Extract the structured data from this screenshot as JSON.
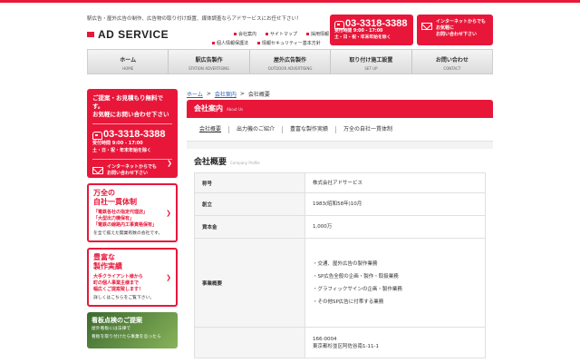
{
  "header": {
    "tagline": "駅広告・屋外広告の制作、広告物の取り付け設置、媒体調査ならアドサービスにお任せ下さい！",
    "logo_text": "AD SERVICE",
    "util_links_row1": [
      "会社案内",
      "サイトマップ",
      "採用情報"
    ],
    "util_links_row2": [
      "個人情報保護法",
      "情報セキュリティー基本方針"
    ],
    "phone": {
      "number": "03-3318-3388",
      "hours": "受付時間 9:00 - 17:00",
      "closed": "土・日・祝・年末年始を除く"
    },
    "net_contact": {
      "line1": "インターネットからでも",
      "line2": "お気軽に",
      "line3": "お問い合わせ下さい"
    }
  },
  "nav": [
    {
      "jp": "ホーム",
      "en": "HOME"
    },
    {
      "jp": "駅広告製作",
      "en": "STATION ADVERTISING"
    },
    {
      "jp": "屋外広告製作",
      "en": "OUTDOOR ADVERTISING"
    },
    {
      "jp": "取り付け施工設置",
      "en": "SET UP"
    },
    {
      "jp": "お問い合わせ",
      "en": "CONTACT"
    }
  ],
  "sidebar": {
    "contact": {
      "line1": "ご提案・お見積もり無料です。",
      "line2": "お気軽にお問い合わせ下さい",
      "number": "03-3318-3388",
      "hours": "受付時間 9:00 - 17:00",
      "closed": "土・日・祝・年末年始を除く",
      "net1": "インターネットからでも",
      "net2": "お問い合わせ下さい"
    },
    "card1": {
      "title1": "万全の",
      "title2": "自社一貫体制",
      "b1": "「電鉄各社の指定代理店」",
      "b2": "「大型出力機保有」",
      "b3": "「電鉄の線路内工事資格保有」",
      "note": "を全て揃えた開業有数の会社です。"
    },
    "card2": {
      "title1": "豊富な",
      "title2": "製作実績",
      "b1": "大手クライアント様から",
      "b2": "町の個人事業主様まで",
      "b3": "幅広くご提案致します！",
      "note": "詳しくはこちらをご覧下さい。"
    },
    "card3": {
      "title": "看板点検のご提案",
      "line1": "屋外看板には法律で",
      "line2": "看板を取り付けたら事業を怠ったら"
    }
  },
  "breadcrumb": {
    "home": "ホーム",
    "sep": ">",
    "parent": "会社案内",
    "current": "会社概要"
  },
  "main": {
    "heading_jp": "会社案内",
    "heading_en": "About Us",
    "tabs": [
      "会社概要",
      "出力機のご紹介",
      "豊富な製作実績",
      "万全の自社一貫体制"
    ],
    "section_jp": "会社概要",
    "section_en": "Company Profile",
    "rows": [
      {
        "key": "称号",
        "value": "株式会社アドサービス"
      },
      {
        "key": "創立",
        "value": "1983(昭和58年)10月"
      },
      {
        "key": "資本金",
        "value": "1,000万"
      }
    ],
    "business_key": "事業概要",
    "business": [
      "・交通、屋外広告の製作業務",
      "・SP広告全般の企画・製作・取扱業務",
      "・グラフィックサインの企画・製作業務",
      "・その他SP広告に付帯する業務"
    ],
    "address": {
      "zip": "166-0004",
      "line": "東京都杉並区阿佐谷南1-11-1"
    }
  },
  "colors": {
    "accent": "#e8173a",
    "link": "#2a5db0"
  }
}
